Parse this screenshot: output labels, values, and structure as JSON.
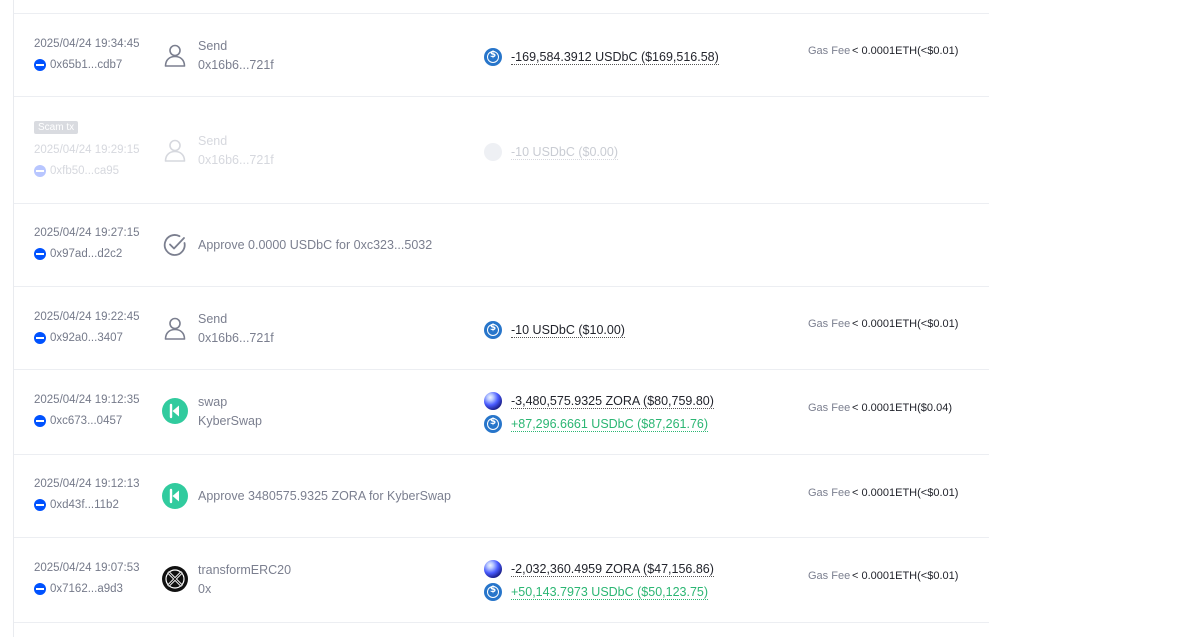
{
  "rows": [
    {
      "time": "2025/04/24 19:34:45",
      "hash": "0x65b1...cdb7",
      "title": "Send",
      "sub": "0x16b6...721f",
      "token1": "-169,584.3912 USDbC ($169,516.58)",
      "gas_label": "Gas Fee",
      "gas_value": "< 0.0001ETH(<$0.01)",
      "icon": "person-icon"
    },
    {
      "badge": "Scam tx",
      "time": "2025/04/24 19:29:15",
      "hash": "0xfb50...ca95",
      "title": "Send",
      "sub": "0x16b6...721f",
      "token1": "-10 USDbC ($0.00)",
      "icon": "person-icon"
    },
    {
      "time": "2025/04/24 19:27:15",
      "hash": "0x97ad...d2c2",
      "title": "Approve 0.0000 USDbC for 0xc323...5032",
      "icon": "check-circle-icon"
    },
    {
      "time": "2025/04/24 19:22:45",
      "hash": "0x92a0...3407",
      "title": "Send",
      "sub": "0x16b6...721f",
      "token1": "-10 USDbC ($10.00)",
      "gas_label": "Gas Fee",
      "gas_value": "< 0.0001ETH(<$0.01)",
      "icon": "person-icon"
    },
    {
      "time": "2025/04/24 19:12:35",
      "hash": "0xc673...0457",
      "title": "swap",
      "sub": "KyberSwap",
      "token1": "-3,480,575.9325 ZORA ($80,759.80)",
      "token2": "+87,296.6661 USDbC ($87,261.76)",
      "gas_label": "Gas Fee",
      "gas_value": "< 0.0001ETH($0.04)",
      "icon": "kyberswap-icon"
    },
    {
      "time": "2025/04/24 19:12:13",
      "hash": "0xd43f...11b2",
      "title": "Approve 3480575.9325 ZORA for KyberSwap",
      "gas_label": "Gas Fee",
      "gas_value": "< 0.0001ETH(<$0.01)",
      "icon": "kyberswap-icon"
    },
    {
      "time": "2025/04/24 19:07:53",
      "hash": "0x7162...a9d3",
      "title": "transformERC20",
      "sub": "0x",
      "token1": "-2,032,360.4959 ZORA ($47,156.86)",
      "token2": "+50,143.7973 USDbC ($50,123.75)",
      "gas_label": "Gas Fee",
      "gas_value": "< 0.0001ETH(<$0.01)",
      "icon": "0x-protocol-icon"
    }
  ],
  "colors": {
    "accent": "#2775ca",
    "positive": "#2bb673",
    "chain": "#0052ff",
    "kyber": "#31cb9e"
  }
}
